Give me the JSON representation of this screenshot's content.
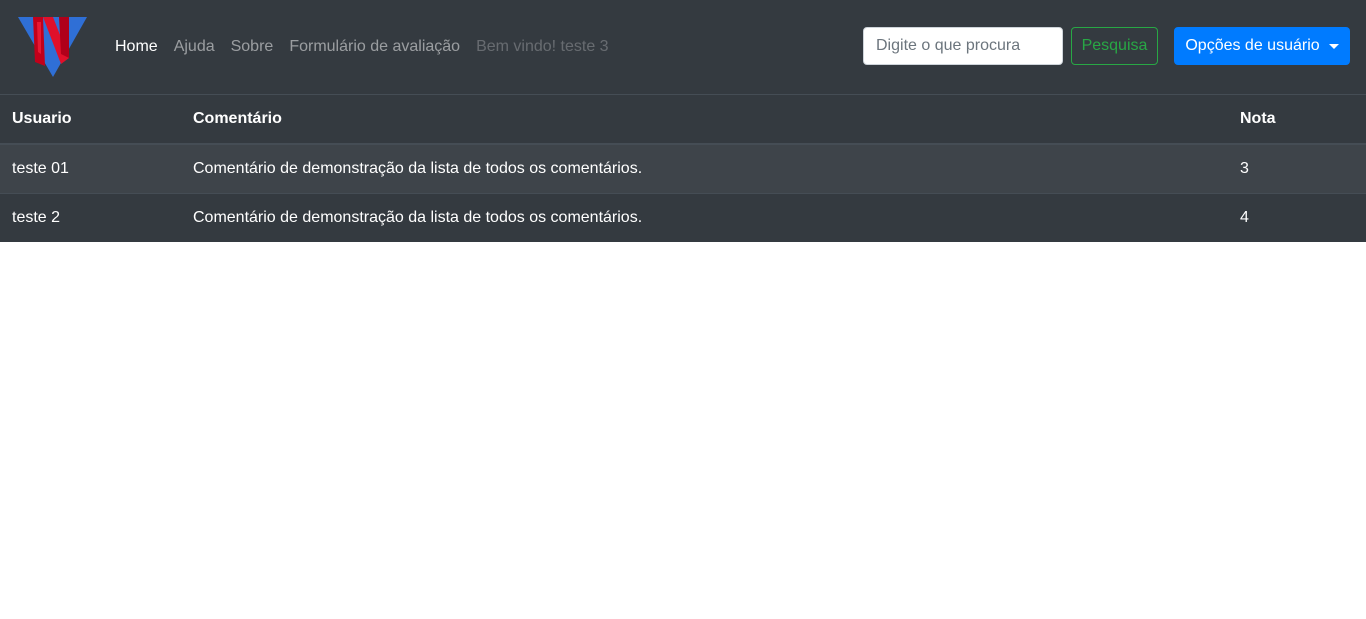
{
  "brand": {
    "logo_icon": "brand-logo-icon",
    "colors": {
      "red": "#d0001a",
      "blue": "#2f6fd6",
      "navbar_bg": "#343a40"
    }
  },
  "nav": {
    "items": [
      {
        "label": "Home",
        "state": "active"
      },
      {
        "label": "Ajuda",
        "state": "normal"
      },
      {
        "label": "Sobre",
        "state": "normal"
      },
      {
        "label": "Formulário de avaliação",
        "state": "normal"
      }
    ],
    "welcome": "Bem vindo! teste 3"
  },
  "search": {
    "placeholder": "Digite o que procura",
    "value": "",
    "button_label": "Pesquisa",
    "button_color": "#28a745"
  },
  "user_menu": {
    "label": "Opções de usuário",
    "color": "#007bff"
  },
  "table": {
    "headers": {
      "user": "Usuario",
      "comment": "Comentário",
      "grade": "Nota"
    },
    "rows": [
      {
        "user": "teste 01",
        "comment": "Comentário de demonstração da lista de todos os comentários.",
        "grade": "3"
      },
      {
        "user": "teste 2",
        "comment": "Comentário de demonstração da lista de todos os comentários.",
        "grade": "4"
      }
    ]
  }
}
